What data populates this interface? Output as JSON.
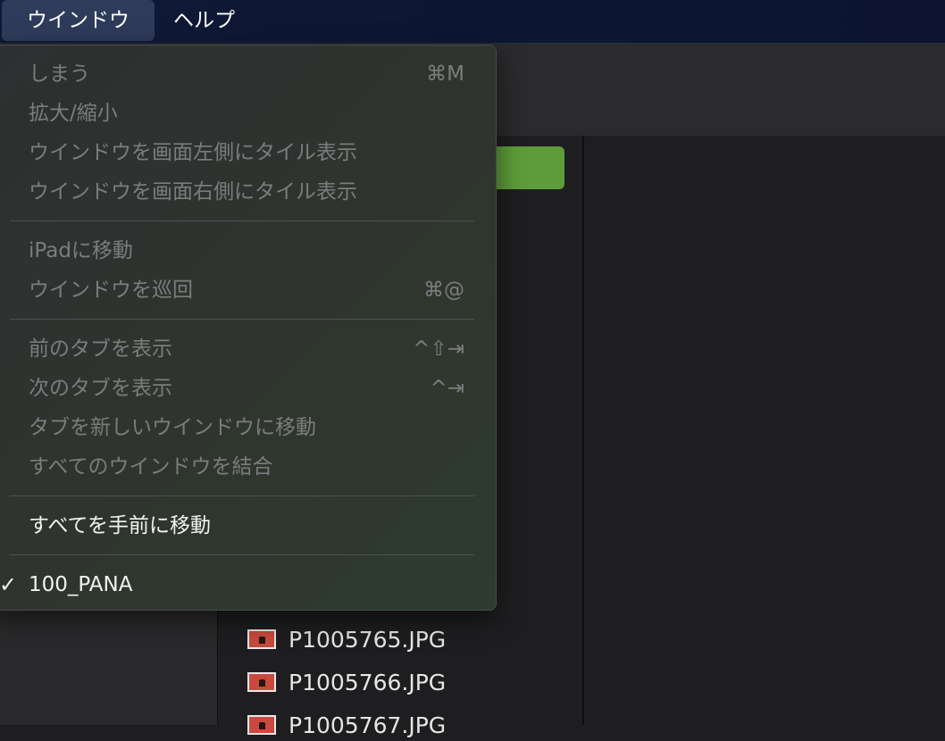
{
  "menubar": {
    "window_label": "ウインドウ",
    "help_label": "ヘルプ"
  },
  "menu": {
    "items": [
      {
        "label": "しまう",
        "shortcut": "⌘M",
        "enabled": false
      },
      {
        "label": "拡大/縮小",
        "shortcut": "",
        "enabled": false
      },
      {
        "label": "ウインドウを画面左側にタイル表示",
        "shortcut": "",
        "enabled": false
      },
      {
        "label": "ウインドウを画面右側にタイル表示",
        "shortcut": "",
        "enabled": false
      },
      {
        "label": "iPadに移動",
        "shortcut": "",
        "enabled": false
      },
      {
        "label": "ウインドウを巡回",
        "shortcut": "⌘@",
        "enabled": false
      },
      {
        "label": "前のタブを表示",
        "shortcut": "^⇧⇥",
        "enabled": false
      },
      {
        "label": "次のタブを表示",
        "shortcut": "^⇥",
        "enabled": false
      },
      {
        "label": "タブを新しいウインドウに移動",
        "shortcut": "",
        "enabled": false
      },
      {
        "label": "すべてのウインドウを結合",
        "shortcut": "",
        "enabled": false
      },
      {
        "label": "すべてを手前に移動",
        "shortcut": "",
        "enabled": true
      },
      {
        "label": "100_PANA",
        "shortcut": "",
        "enabled": true,
        "checked": true
      }
    ]
  },
  "files": [
    {
      "name": "P1005765.JPG"
    },
    {
      "name": "P1005766.JPG"
    },
    {
      "name": "P1005767.JPG"
    }
  ],
  "colors": {
    "accent_green": "#5e9c3a",
    "menubar_bg": "#0d1733",
    "file_icon": "#c84a3e"
  }
}
